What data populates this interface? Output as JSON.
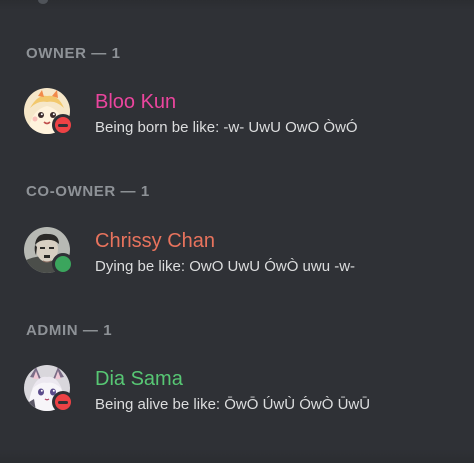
{
  "sections": [
    {
      "header": "OWNER — 1",
      "member": {
        "name": "Bloo Kun",
        "name_color": "#eb459e",
        "custom_status": "Being born be like:  -w- UwU OwO ÒwÓ",
        "status": "dnd",
        "avatar": "anime-girl-avatar"
      }
    },
    {
      "header": "CO-OWNER — 1",
      "member": {
        "name": "Chrissy Chan",
        "name_color": "#e8735d",
        "custom_status": "Dying be like: OwO UwU ÓwÒ uwu -w-",
        "status": "online",
        "avatar": "man-portrait-avatar"
      }
    },
    {
      "header": "ADMIN — 1",
      "member": {
        "name": "Dia Sama",
        "name_color": "#57c774",
        "custom_status": "Being alive be like: ŌwŌ ÚwÙ ÓwÒ ŪwŪ",
        "status": "dnd",
        "avatar": "anime-cat-girl-avatar"
      }
    }
  ],
  "colors": {
    "background": "#2f3136",
    "header_text": "#8e9297",
    "status_dnd": "#ed4245",
    "status_online": "#3ba55d"
  }
}
